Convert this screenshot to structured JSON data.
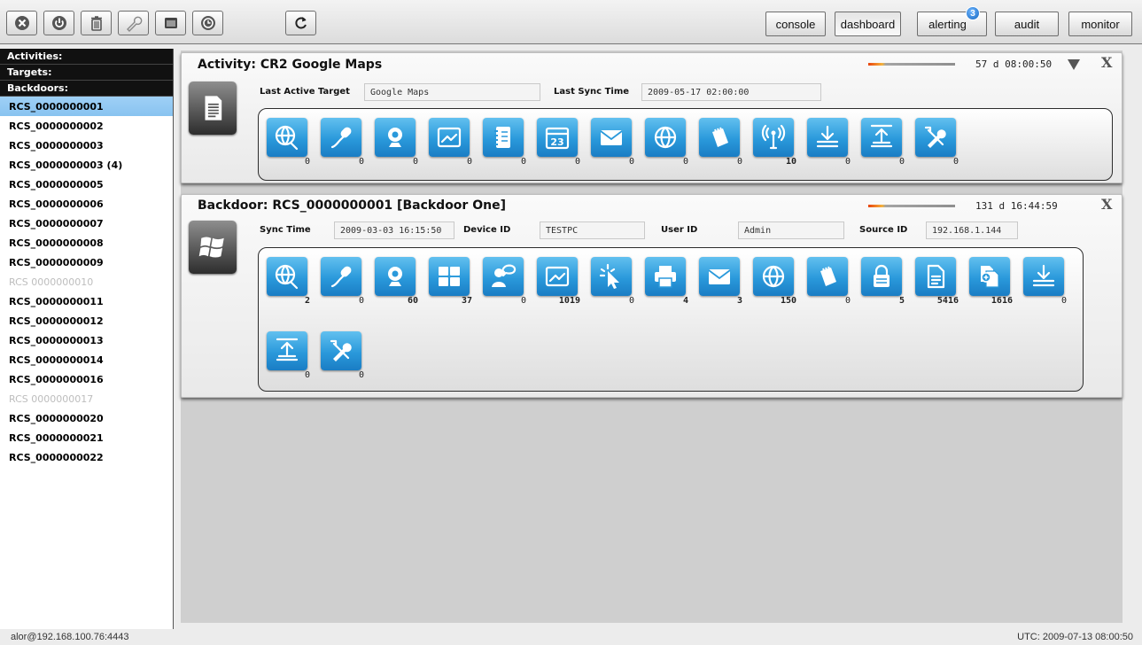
{
  "toolbar": {
    "icons": [
      {
        "name": "close-circle-icon"
      },
      {
        "name": "power-icon"
      },
      {
        "name": "trash-icon"
      },
      {
        "name": "wrench-icon"
      },
      {
        "name": "window-icon"
      },
      {
        "name": "clock-icon"
      },
      {
        "name": "refresh-icon"
      }
    ],
    "buttons": [
      {
        "label": "console"
      },
      {
        "label": "dashboard"
      },
      {
        "label": "alerting",
        "badge": "3"
      },
      {
        "label": "audit"
      },
      {
        "label": "monitor"
      }
    ]
  },
  "sidebar": {
    "activities_label": "Activities:",
    "targets_label": "Targets:",
    "backdoors_label": "Backdoors:",
    "items": [
      {
        "label": "RCS_0000000001",
        "state": "selected"
      },
      {
        "label": "RCS_0000000002",
        "state": "normal"
      },
      {
        "label": "RCS_0000000003",
        "state": "normal"
      },
      {
        "label": "RCS_0000000003 (4)",
        "state": "normal"
      },
      {
        "label": "RCS_0000000005",
        "state": "normal"
      },
      {
        "label": "RCS_0000000006",
        "state": "normal"
      },
      {
        "label": "RCS_0000000007",
        "state": "normal"
      },
      {
        "label": "RCS_0000000008",
        "state": "normal"
      },
      {
        "label": "RCS_0000000009",
        "state": "normal"
      },
      {
        "label": "RCS 0000000010",
        "state": "disabled"
      },
      {
        "label": "RCS_0000000011",
        "state": "normal"
      },
      {
        "label": "RCS_0000000012",
        "state": "normal"
      },
      {
        "label": "RCS_0000000013",
        "state": "normal"
      },
      {
        "label": "RCS_0000000014",
        "state": "normal"
      },
      {
        "label": "RCS_0000000016",
        "state": "normal"
      },
      {
        "label": "RCS 0000000017",
        "state": "disabled"
      },
      {
        "label": "RCS_0000000020",
        "state": "normal"
      },
      {
        "label": "RCS_0000000021",
        "state": "normal"
      },
      {
        "label": "RCS_0000000022",
        "state": "normal"
      }
    ]
  },
  "activity_panel": {
    "title": "Activity: CR2 Google Maps",
    "uptime": "57 d 08:00:50",
    "fields": {
      "last_active_target_label": "Last Active Target",
      "last_active_target_value": "Google Maps",
      "last_sync_label": "Last Sync Time",
      "last_sync_value": "2009-05-17 02:00:00"
    },
    "modules": [
      {
        "icon": "globe-phone-icon",
        "count": "0"
      },
      {
        "icon": "microphone-icon",
        "count": "0"
      },
      {
        "icon": "webcam-icon",
        "count": "0"
      },
      {
        "icon": "screenshot-icon",
        "count": "0"
      },
      {
        "icon": "addressbook-icon",
        "count": "0"
      },
      {
        "icon": "calendar-icon",
        "count": "0",
        "text": "23"
      },
      {
        "icon": "envelope-icon",
        "count": "0"
      },
      {
        "icon": "url-globe-icon",
        "count": "0"
      },
      {
        "icon": "device-note-icon",
        "count": "0"
      },
      {
        "icon": "antenna-icon",
        "count": "10"
      },
      {
        "icon": "download-icon",
        "count": "0"
      },
      {
        "icon": "upload-icon",
        "count": "0"
      },
      {
        "icon": "tools-icon",
        "count": "0"
      }
    ]
  },
  "backdoor_panel": {
    "title": "Backdoor: RCS_0000000001 [Backdoor One]",
    "uptime": "131 d 16:44:59",
    "fields": {
      "sync_time_label": "Sync Time",
      "sync_time_value": "2009-03-03 16:15:50",
      "device_id_label": "Device ID",
      "device_id_value": "TESTPC",
      "user_id_label": "User ID",
      "user_id_value": "Admin",
      "source_id_label": "Source ID",
      "source_id_value": "192.168.1.144"
    },
    "modules": [
      {
        "icon": "globe-phone-icon",
        "count": "2"
      },
      {
        "icon": "microphone-icon",
        "count": "0"
      },
      {
        "icon": "webcam-icon",
        "count": "60"
      },
      {
        "icon": "keylog-icon",
        "count": "37"
      },
      {
        "icon": "chat-icon",
        "count": "0"
      },
      {
        "icon": "screenshot-icon",
        "count": "1019"
      },
      {
        "icon": "mouse-click-icon",
        "count": "0"
      },
      {
        "icon": "printer-icon",
        "count": "4"
      },
      {
        "icon": "envelope-icon",
        "count": "3"
      },
      {
        "icon": "url-globe-icon",
        "count": "150"
      },
      {
        "icon": "device-note-icon",
        "count": "0"
      },
      {
        "icon": "password-lock-icon",
        "count": "5"
      },
      {
        "icon": "file-icon",
        "count": "5416"
      },
      {
        "icon": "file-capture-icon",
        "count": "1616"
      },
      {
        "icon": "download-icon",
        "count": "0"
      },
      {
        "icon": "upload-icon",
        "count": "0"
      },
      {
        "icon": "tools-icon",
        "count": "0"
      }
    ]
  },
  "status_bar": {
    "connection": "alor@192.168.100.76:4443",
    "utc": "UTC: 2009-07-13 08:00:50"
  }
}
